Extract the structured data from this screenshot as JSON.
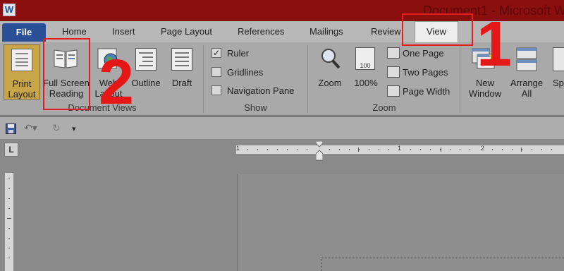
{
  "titlebar": {
    "title": "Document1 - Microsoft W",
    "app_icon": "W"
  },
  "tabs": {
    "file": "File",
    "home": "Home",
    "insert": "Insert",
    "page_layout": "Page Layout",
    "references": "References",
    "mailings": "Mailings",
    "review": "Review",
    "view": "View"
  },
  "ribbon": {
    "document_views": {
      "label": "Document Views",
      "print_layout": [
        "Print",
        "Layout"
      ],
      "full_screen_reading": [
        "Full Screen",
        "Reading"
      ],
      "web_layout": [
        "Web",
        "Layout"
      ],
      "outline": "Outline",
      "draft": "Draft"
    },
    "show": {
      "label": "Show",
      "ruler": {
        "label": "Ruler",
        "checked": true
      },
      "gridlines": {
        "label": "Gridlines",
        "checked": false
      },
      "navigation_pane": {
        "label": "Navigation Pane",
        "checked": false
      }
    },
    "zoom": {
      "label": "Zoom",
      "zoom": "Zoom",
      "percent": "100%",
      "one_page": "One Page",
      "two_pages": "Two Pages",
      "page_width": "Page Width",
      "icon_text": "100"
    },
    "window": {
      "new_window": [
        "New",
        "Window"
      ],
      "arrange_all": [
        "Arrange",
        "All"
      ],
      "split": "Sp"
    }
  },
  "ruler": {
    "corner": "L",
    "marks": [
      "1",
      "1",
      "2"
    ]
  },
  "annotations": {
    "step1": "1",
    "step2": "2"
  },
  "colors": {
    "highlight": "#e02020",
    "file_tab": "#2b4f96",
    "titlebar": "#8c0f0f"
  }
}
